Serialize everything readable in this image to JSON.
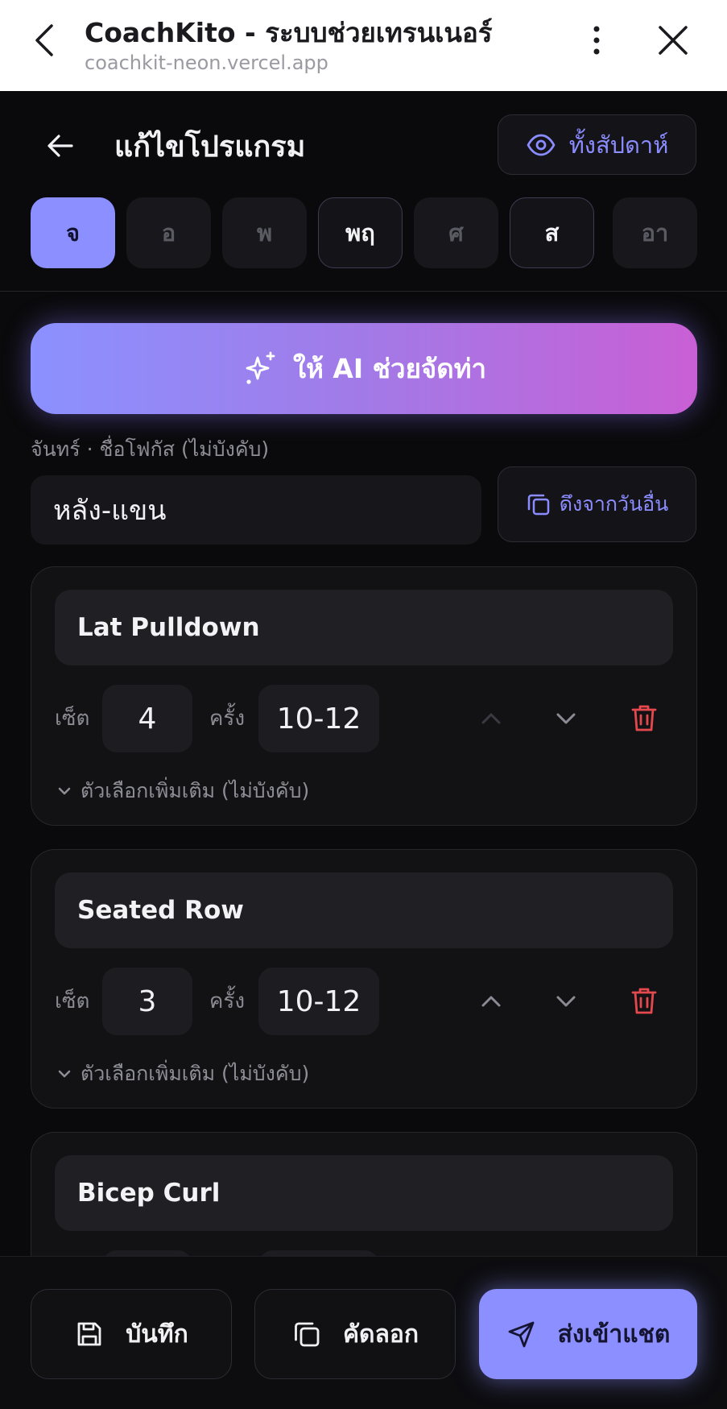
{
  "browser": {
    "title": "CoachKito - ระบบช่วยเทรนเนอร์",
    "url": "coachkit-neon.vercel.app"
  },
  "header": {
    "title": "แก้ไขโปรแกรม",
    "week_button": "ทั้งสัปดาห์"
  },
  "days": [
    {
      "label": "จ",
      "state": "active"
    },
    {
      "label": "อ",
      "state": "empty"
    },
    {
      "label": "พ",
      "state": "empty"
    },
    {
      "label": "พฤ",
      "state": "has-program"
    },
    {
      "label": "ศ",
      "state": "empty"
    },
    {
      "label": "ส",
      "state": "has-program"
    },
    {
      "label": "อา",
      "state": "empty"
    }
  ],
  "ai_button": "ให้ AI ช่วยจัดท่า",
  "focus": {
    "label": "จันทร์ · ชื่อโฟกัส (ไม่บังคับ)",
    "value": "หลัง-แขน",
    "pull_button": "ดึงจากวันอื่น"
  },
  "labels": {
    "sets": "เซ็ต",
    "reps": "ครั้ง",
    "more_options": "ตัวเลือกเพิ่มเติม (ไม่บังคับ)"
  },
  "exercises": [
    {
      "name": "Lat Pulldown",
      "sets": "4",
      "reps": "10-12",
      "up_disabled": true
    },
    {
      "name": "Seated Row",
      "sets": "3",
      "reps": "10-12",
      "up_disabled": false
    },
    {
      "name": "Bicep Curl",
      "sets": "",
      "reps": "",
      "up_disabled": false
    }
  ],
  "footer": {
    "save": "บันทึก",
    "copy": "คัดลอก",
    "send": "ส่งเข้าแชต"
  },
  "colors": {
    "accent": "#8b8fff",
    "danger": "#e5484d",
    "gradient_start": "#8b91ff",
    "gradient_end": "#c95fd5"
  }
}
